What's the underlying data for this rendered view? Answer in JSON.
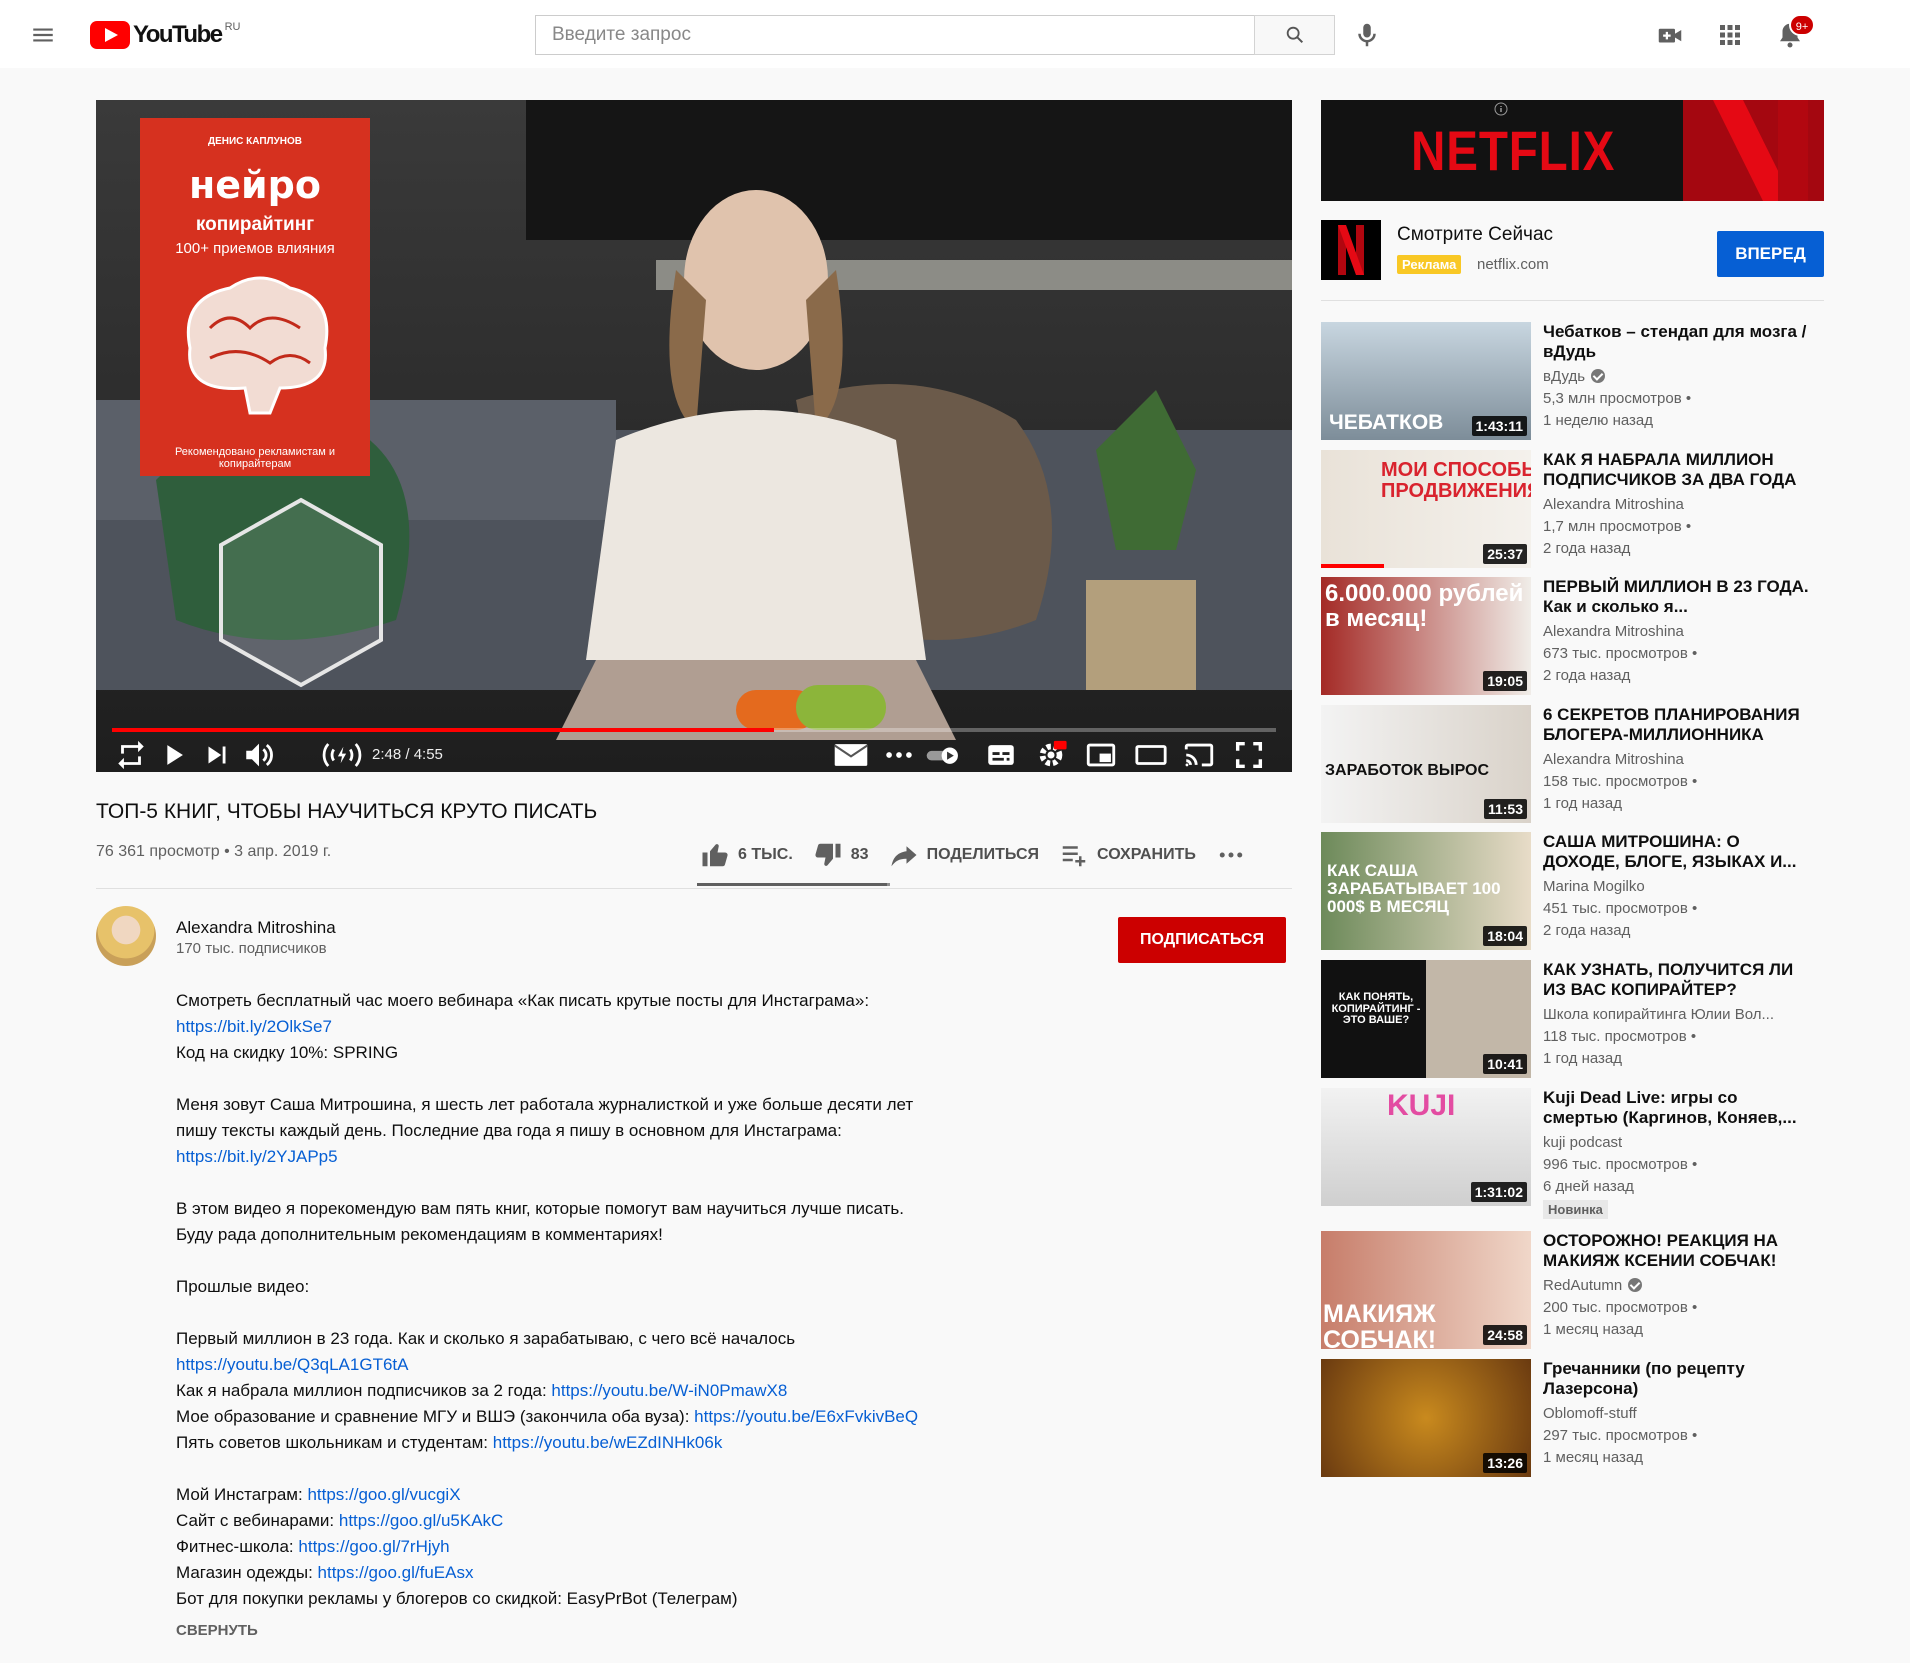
{
  "header": {
    "logo_text": "YouTube",
    "logo_region": "RU",
    "search_placeholder": "Введите запрос",
    "notifications_badge": "9+"
  },
  "player": {
    "time": "2:48 / 4:55",
    "progress_fraction": 0.569,
    "book": {
      "author": "ДЕНИС КАПЛУНОВ",
      "title": "нейро",
      "subtitle": "копирайтинг",
      "tagline": "100+ приемов влияния",
      "bottom": "Рекомендовано рекламистам и копирайтерам"
    }
  },
  "video": {
    "title": "ТОП-5 КНИГ, ЧТОБЫ НАУЧИТЬСЯ КРУТО ПИСАТЬ",
    "info": "76 361 просмотр • 3 апр. 2019 г.",
    "likes": "6 тыс.",
    "dislikes": "83",
    "share": "Поделиться",
    "save": "Сохранить",
    "like_ratio": 0.986
  },
  "owner": {
    "name": "Alexandra Mitroshina",
    "subscribers": "170 тыс. подписчиков",
    "subscribe_label": "ПОДПИСАТЬСЯ"
  },
  "description": {
    "lines": [
      {
        "text": "Смотреть бесплатный час моего вебинара «Как писать крутые посты для Инстаграма»:",
        "link": ""
      },
      {
        "text": "",
        "link": "https://bit.ly/2OlkSe7"
      },
      {
        "text": "Код на скидку 10%: SPRING",
        "link": ""
      },
      {
        "text": "",
        "link": ""
      },
      {
        "text": "Меня зовут Саша Митрошина, я шесть лет работала журналисткой и уже больше десяти лет",
        "link": ""
      },
      {
        "text": "пишу тексты каждый день. Последние два года я пишу в основном для Инстаграма:",
        "link": ""
      },
      {
        "text": "",
        "link": "https://bit.ly/2YJAPp5"
      },
      {
        "text": "",
        "link": ""
      },
      {
        "text": "В этом видео я порекомендую вам пять книг, которые помогут вам научиться лучше писать.",
        "link": ""
      },
      {
        "text": "Буду рада дополнительным рекомендациям в комментариях!",
        "link": ""
      },
      {
        "text": "",
        "link": ""
      },
      {
        "text": "Прошлые видео:",
        "link": ""
      },
      {
        "text": "",
        "link": ""
      },
      {
        "text": "Первый миллион в 23 года. Как и сколько я зарабатываю, с чего всё началось",
        "link": ""
      },
      {
        "text": "",
        "link": "https://youtu.be/Q3qLA1GT6tA"
      },
      {
        "text": "Как я набрала миллион подписчиков за 2 года: ",
        "link": "https://youtu.be/W-iN0PmawX8"
      },
      {
        "text": "Мое образование и сравнение МГУ и ВШЭ (закончила оба вуза): ",
        "link": "https://youtu.be/E6xFvkivBeQ"
      },
      {
        "text": "Пять советов школьникам и студентам: ",
        "link": "https://youtu.be/wEZdINHk06k"
      },
      {
        "text": "",
        "link": ""
      },
      {
        "text": "Мой Инстаграм: ",
        "link": "https://goo.gl/vucgiX"
      },
      {
        "text": "Сайт с вебинарами: ",
        "link": "https://goo.gl/u5KAkC"
      },
      {
        "text": "Фитнес-школа: ",
        "link": "https://goo.gl/7rHjyh"
      },
      {
        "text": "Магазин одежды: ",
        "link": "https://goo.gl/fuEAsx"
      },
      {
        "text": "Бот для покупки рекламы у блогеров со скидкой: EasyPrBot (Телеграм)",
        "link": ""
      }
    ],
    "collapse_label": "СВЕРНУТЬ"
  },
  "ad": {
    "banner_text": "NETFLIX",
    "title": "Смотрите Сейчас",
    "badge": "Реклама",
    "domain": "netflix.com",
    "cta": "ВПЕРЕД"
  },
  "recommendations": [
    {
      "title": "Чебатков – стендап для мозга / вДудь",
      "channel": "вДудь",
      "verified": true,
      "views": "5,3 млн просмотров",
      "age": "1 неделю назад",
      "duration": "1:43:11",
      "thumb_text": "ЧЕБАТКОВ",
      "badge": "",
      "watched": 0.0
    },
    {
      "title": "КАК Я НАБРАЛА МИЛЛИОН ПОДПИСЧИКОВ ЗА ДВА ГОДА",
      "channel": "Alexandra Mitroshina",
      "verified": false,
      "views": "1,7 млн просмотров",
      "age": "2 года назад",
      "duration": "25:37",
      "thumb_text": "МОИ СПОСОБЫ ПРОДВИЖЕНИЯ",
      "badge": "",
      "watched": 0.3
    },
    {
      "title": "ПЕРВЫЙ МИЛЛИОН В 23 ГОДА. Как и сколько я...",
      "channel": "Alexandra Mitroshina",
      "verified": false,
      "views": "673 тыс. просмотров",
      "age": "2 года назад",
      "duration": "19:05",
      "thumb_text": "6.000.000 рублей в месяц!",
      "badge": "",
      "watched": 0.0
    },
    {
      "title": "6 СЕКРЕТОВ ПЛАНИРОВАНИЯ БЛОГЕРА-МИЛЛИОННИКА",
      "channel": "Alexandra Mitroshina",
      "verified": false,
      "views": "158 тыс. просмотров",
      "age": "1 год назад",
      "duration": "11:53",
      "thumb_text": "ЗАРАБОТОК ВЫРОС",
      "badge": "",
      "watched": 0.0
    },
    {
      "title": "САША МИТРОШИНА: О ДОХОДЕ, БЛОГЕ, ЯЗЫКАХ И...",
      "channel": "Marina Mogilko",
      "verified": false,
      "views": "451 тыс. просмотров",
      "age": "2 года назад",
      "duration": "18:04",
      "thumb_text": "КАК САША ЗАРАБАТЫВАЕТ 100 000$ В МЕСЯЦ",
      "badge": "",
      "watched": 0.0
    },
    {
      "title": "КАК УЗНАТЬ, ПОЛУЧИТСЯ ЛИ ИЗ ВАС КОПИРАЙТЕР?",
      "channel": "Школа копирайтинга Юлии Вол...",
      "verified": false,
      "views": "118 тыс. просмотров",
      "age": "1 год назад",
      "duration": "10:41",
      "thumb_text": "КАК ПОНЯТЬ, КОПИРАЙТИНГ - ЭТО ВАШЕ?",
      "badge": "",
      "watched": 0.0
    },
    {
      "title": "Kuji Dead Live: игры со смертью (Каргинов, Коняев,...",
      "channel": "kuji podcast",
      "verified": false,
      "views": "996 тыс. просмотров",
      "age": "6 дней назад",
      "duration": "1:31:02",
      "thumb_text": "KUJI",
      "badge": "Новинка",
      "watched": 0.0
    },
    {
      "title": "ОСТОРОЖНО! РЕАКЦИЯ НА МАКИЯЖ КСЕНИИ СОБЧАК!",
      "channel": "RedAutumn",
      "verified": true,
      "views": "200 тыс. просмотров",
      "age": "1 месяц назад",
      "duration": "24:58",
      "thumb_text": "МАКИЯЖ СОБЧАК!",
      "badge": "",
      "watched": 0.0
    },
    {
      "title": "Гречанники (по рецепту Лазерсона)",
      "channel": "Oblomoff-stuff",
      "verified": false,
      "views": "297 тыс. просмотров",
      "age": "1 месяц назад",
      "duration": "13:26",
      "thumb_text": "",
      "badge": "",
      "watched": 0.0
    }
  ]
}
